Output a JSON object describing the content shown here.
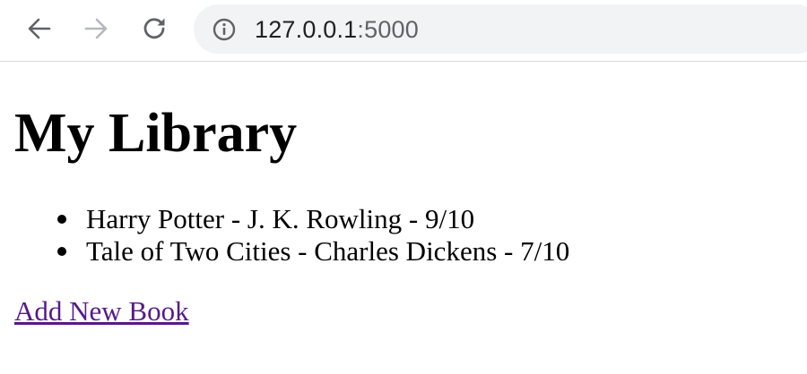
{
  "browser": {
    "url_host": "127.0.0.1",
    "url_port": ":5000",
    "back_icon": "arrow-left-icon",
    "forward_icon": "arrow-right-icon",
    "reload_icon": "reload-icon",
    "site_info_icon": "info-circle-icon"
  },
  "page": {
    "title": "My Library",
    "books": [
      "Harry Potter - J. K. Rowling - 9/10",
      "Tale of Two Cities - Charles Dickens - 7/10"
    ],
    "add_link_label": "Add New Book",
    "link_color": "#551a8b"
  }
}
